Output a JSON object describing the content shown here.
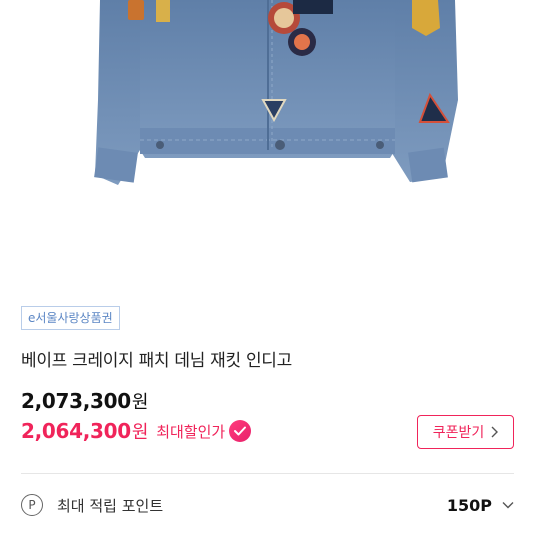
{
  "product": {
    "gift_card_tag": "e서울사랑상품권",
    "title": "베이프 크레이지 패치 데님 재킷 인디고",
    "original_price": "2,073,300",
    "currency_suffix": "원",
    "sale_price": "2,064,300",
    "sale_label": "최대할인가"
  },
  "coupon": {
    "label": "쿠폰받기",
    "icon": "chevron-right-icon"
  },
  "points": {
    "icon": "point-p-icon",
    "icon_letter": "P",
    "label": "최대 적립 포인트",
    "value": "150P",
    "toggle_icon": "chevron-down-icon"
  },
  "colors": {
    "accent": "#f0245a",
    "tag_text": "#5b86c4",
    "tag_border": "#b9cde9"
  }
}
